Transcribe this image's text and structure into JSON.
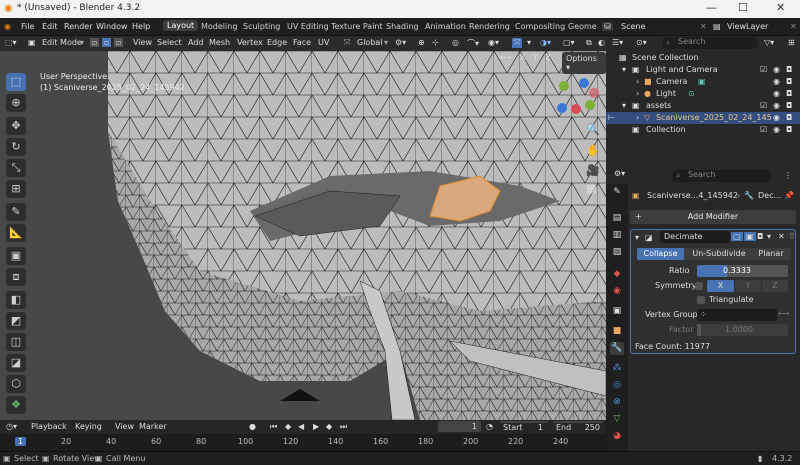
{
  "window": {
    "title": "* (Unsaved) - Blender 4.3.2",
    "controls": [
      "—",
      "☐",
      "✕"
    ]
  },
  "menu": {
    "items": [
      "File",
      "Edit",
      "Render",
      "Window",
      "Help"
    ]
  },
  "workspaces": {
    "tabs": [
      "Layout",
      "Modeling",
      "Sculpting",
      "UV Editing",
      "Texture Paint",
      "Shading",
      "Animation",
      "Rendering",
      "Compositing",
      "Geome"
    ],
    "active": "Layout"
  },
  "scene": {
    "label": "Scene",
    "viewlayer": "ViewLayer"
  },
  "header3d": {
    "mode": "Edit Mode",
    "menus": [
      "View",
      "Select",
      "Add",
      "Mesh",
      "Vertex",
      "Edge",
      "Face",
      "UV"
    ],
    "orientation": "Global",
    "axes": [
      "X",
      "Y",
      "Z"
    ],
    "options": "Options"
  },
  "overlay": {
    "perspective": "User Perspective",
    "object": "(1) Scaniverse_2025_02_24_145942"
  },
  "outliner": {
    "search": "Search",
    "rows": [
      "Scene Collection",
      "Light and Camera",
      "Camera",
      "Light",
      "assets",
      "Scaniverse_2025_02_24_145",
      "Collection"
    ]
  },
  "properties": {
    "search": "Search",
    "breadcrumb_object": "Scaniverse...4_145942",
    "breadcrumb_mod": "Dec...",
    "add_modifier": "Add Modifier",
    "modifier_name": "Decimate",
    "tabs": [
      "Collapse",
      "Un-Subdivide",
      "Planar"
    ],
    "ratio_label": "Ratio",
    "ratio_value": "0.3333",
    "ratio_fraction": 0.3333,
    "symmetry_label": "Symmetry",
    "sym_axes": [
      "X",
      "Y",
      "Z"
    ],
    "triangulate": "Triangulate",
    "vertex_group": "Vertex Group",
    "factor_label": "Factor",
    "factor_value": "1.0000",
    "face_count": "Face Count: 11977"
  },
  "timeline": {
    "playback": "Playback",
    "keying": "Keying",
    "view": "View",
    "marker": "Marker",
    "current": "1",
    "start_label": "Start",
    "start": "1",
    "end_label": "End",
    "end": "250"
  },
  "ruler": {
    "ticks": [
      "1",
      "20",
      "40",
      "60",
      "80",
      "100",
      "120",
      "140",
      "160",
      "180",
      "200",
      "220",
      "240"
    ]
  },
  "status": {
    "items": [
      "Select",
      "Rotate View",
      "Call Menu"
    ],
    "version": "4.3.2"
  }
}
